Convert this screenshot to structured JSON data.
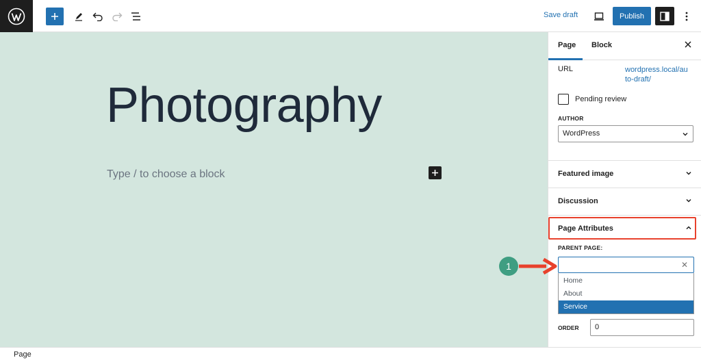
{
  "topbar": {
    "save_draft": "Save draft",
    "publish": "Publish",
    "icons": [
      "wordpress-icon",
      "plus-icon",
      "pencil-icon",
      "undo-icon",
      "redo-icon",
      "list-view-icon",
      "desktop-preview-icon",
      "settings-sidebar-icon",
      "more-options-icon"
    ]
  },
  "canvas": {
    "title": "Photography",
    "placeholder": "Type / to choose a block"
  },
  "sidebar": {
    "tabs": [
      "Page",
      "Block"
    ],
    "url_label": "URL",
    "url_value": "wordpress.local/auto-draft/",
    "pending_review": "Pending review",
    "author_label": "AUTHOR",
    "author_value": "WordPress",
    "panels": [
      "Featured image",
      "Discussion",
      "Page Attributes"
    ],
    "parent_page_label": "PARENT PAGE:",
    "parent_options": [
      "Home",
      "About",
      "Service"
    ],
    "selected_option": "Service",
    "order_label": "ORDER",
    "order_value": "0"
  },
  "statusbar": {
    "text": "Page"
  },
  "annotation": {
    "badge": "1",
    "highlight_color": "#e8412c",
    "badge_color": "#3f9e82"
  },
  "colors": {
    "accent": "#2271b1",
    "canvas_bg": "#d3e6de",
    "dark": "#1e1e1e"
  }
}
